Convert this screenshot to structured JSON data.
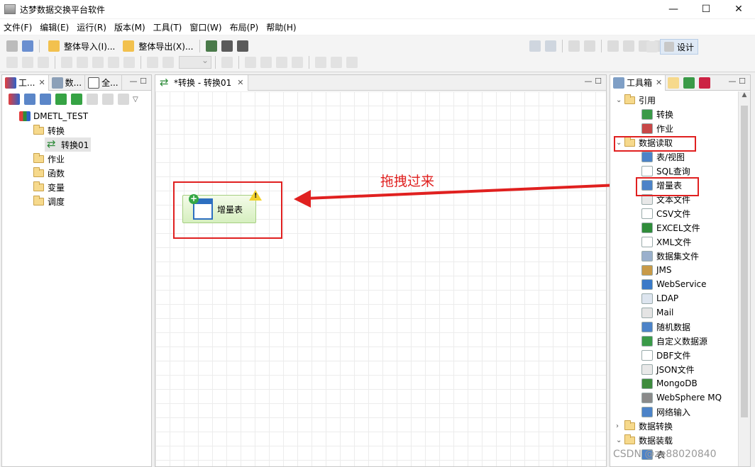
{
  "window": {
    "title": "达梦数据交换平台软件",
    "minimize": "—",
    "maximize": "☐",
    "close": "✕"
  },
  "menu": [
    "文件(F)",
    "编辑(E)",
    "运行(R)",
    "版本(M)",
    "工具(T)",
    "窗口(W)",
    "布局(P)",
    "帮助(H)"
  ],
  "toolbar": {
    "import_label": "整体导入(I)...",
    "export_label": "整体导出(X)...",
    "design_label": "设计"
  },
  "left_panel": {
    "tabs": [
      "工...",
      "数...",
      "全..."
    ],
    "tree": {
      "root": "DMETL_TEST",
      "folder_transform": "转换",
      "transform_item": "转换01",
      "folder_job": "作业",
      "folder_function": "函数",
      "folder_variable": "变量",
      "folder_schedule": "调度"
    }
  },
  "editor": {
    "tab_label": "*转换 - 转换01",
    "node_label": "增量表"
  },
  "annotation": "拖拽过来",
  "right_panel": {
    "tab_label": "工具箱",
    "items": [
      {
        "label": "引用",
        "kind": "folder",
        "state": "open"
      },
      {
        "label": "转换",
        "kind": "leaf",
        "icon": "transform-icon"
      },
      {
        "label": "作业",
        "kind": "leaf",
        "icon": "job-icon"
      },
      {
        "label": "数据读取",
        "kind": "folder",
        "state": "open"
      },
      {
        "label": "表/视图",
        "kind": "leaf",
        "icon": "table-icon"
      },
      {
        "label": "SQL查询",
        "kind": "leaf",
        "icon": "sql-icon"
      },
      {
        "label": "增量表",
        "kind": "leaf",
        "icon": "incremental-table-icon"
      },
      {
        "label": "文本文件",
        "kind": "leaf",
        "icon": "text-file-icon"
      },
      {
        "label": "CSV文件",
        "kind": "leaf",
        "icon": "csv-icon"
      },
      {
        "label": "EXCEL文件",
        "kind": "leaf",
        "icon": "excel-icon"
      },
      {
        "label": "XML文件",
        "kind": "leaf",
        "icon": "xml-icon"
      },
      {
        "label": "数据集文件",
        "kind": "leaf",
        "icon": "dataset-icon"
      },
      {
        "label": "JMS",
        "kind": "leaf",
        "icon": "jms-icon"
      },
      {
        "label": "WebService",
        "kind": "leaf",
        "icon": "webservice-icon"
      },
      {
        "label": "LDAP",
        "kind": "leaf",
        "icon": "ldap-icon"
      },
      {
        "label": "Mail",
        "kind": "leaf",
        "icon": "mail-icon"
      },
      {
        "label": "随机数据",
        "kind": "leaf",
        "icon": "random-icon"
      },
      {
        "label": "自定义数据源",
        "kind": "leaf",
        "icon": "custom-source-icon"
      },
      {
        "label": "DBF文件",
        "kind": "leaf",
        "icon": "dbf-icon"
      },
      {
        "label": "JSON文件",
        "kind": "leaf",
        "icon": "json-icon"
      },
      {
        "label": "MongoDB",
        "kind": "leaf",
        "icon": "mongodb-icon"
      },
      {
        "label": "WebSphere MQ",
        "kind": "leaf",
        "icon": "mq-icon"
      },
      {
        "label": "网络输入",
        "kind": "leaf",
        "icon": "network-input-icon"
      },
      {
        "label": "数据转换",
        "kind": "folder",
        "state": "closed"
      },
      {
        "label": "数据装载",
        "kind": "folder",
        "state": "open"
      },
      {
        "label": "表",
        "kind": "leaf",
        "icon": "table-icon"
      }
    ]
  },
  "watermark": "CSDN @ze88020840",
  "colors": {
    "annotation_red": "#e0201f",
    "node_green": "#d6efbf"
  }
}
